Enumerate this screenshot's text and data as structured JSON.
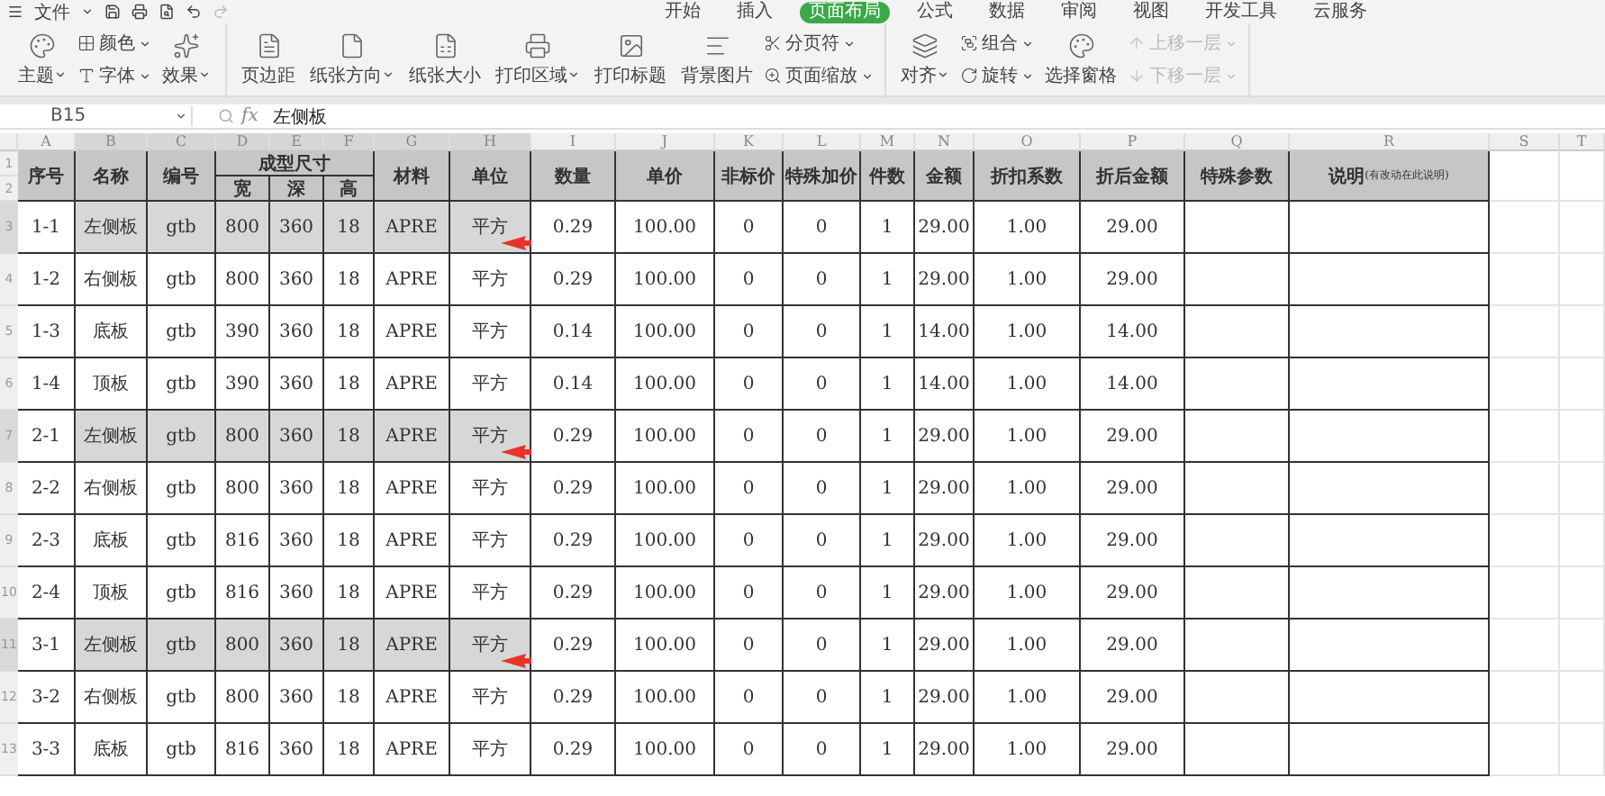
{
  "menu": {
    "file": "文件"
  },
  "ribbon_tabs": [
    {
      "label": "开始",
      "selected": false
    },
    {
      "label": "插入",
      "selected": false
    },
    {
      "label": "页面布局",
      "selected": true
    },
    {
      "label": "公式",
      "selected": false
    },
    {
      "label": "数据",
      "selected": false
    },
    {
      "label": "审阅",
      "selected": false
    },
    {
      "label": "视图",
      "selected": false
    },
    {
      "label": "开发工具",
      "selected": false
    },
    {
      "label": "云服务",
      "selected": false
    }
  ],
  "toolbar": [
    [
      {
        "kind": "big",
        "label": "主题",
        "dropdown": true
      },
      {
        "kind": "pair",
        "items": [
          {
            "label": "颜色",
            "disabled": false
          },
          {
            "label": "字体",
            "disabled": false
          }
        ]
      },
      {
        "kind": "big",
        "label": "效果",
        "dropdown": true
      }
    ],
    [
      {
        "kind": "big",
        "label": "页边距",
        "dropdown": false
      },
      {
        "kind": "big",
        "label": "纸张方向",
        "dropdown": true
      },
      {
        "kind": "big",
        "label": "纸张大小",
        "dropdown": false
      },
      {
        "kind": "big",
        "label": "打印区域",
        "dropdown": true
      },
      {
        "kind": "big",
        "label": "打印标题",
        "dropdown": false
      },
      {
        "kind": "big",
        "label": "背景图片",
        "dropdown": false
      },
      {
        "kind": "pair",
        "items": [
          {
            "label": "分页符",
            "disabled": false
          },
          {
            "label": "页面缩放",
            "disabled": false
          }
        ]
      }
    ],
    [
      {
        "kind": "big",
        "label": "对齐",
        "dropdown": true
      },
      {
        "kind": "pair",
        "items": [
          {
            "label": "组合",
            "disabled": false
          },
          {
            "label": "旋转",
            "disabled": false
          }
        ]
      },
      {
        "kind": "big",
        "label": "选择窗格",
        "dropdown": false
      },
      {
        "kind": "pair",
        "items": [
          {
            "label": "上移一层",
            "disabled": true
          },
          {
            "label": "下移一层",
            "disabled": true
          }
        ]
      }
    ]
  ],
  "formula_bar": {
    "cell_ref": "B15",
    "fx": "fx",
    "value": "左侧板"
  },
  "sheet": {
    "column_letters": [
      {
        "label": "A",
        "selected": false
      },
      {
        "label": "B",
        "selected": true
      },
      {
        "label": "C",
        "selected": true
      },
      {
        "label": "D",
        "selected": true
      },
      {
        "label": "E",
        "selected": true
      },
      {
        "label": "F",
        "selected": true
      },
      {
        "label": "G",
        "selected": true
      },
      {
        "label": "H",
        "selected": true
      },
      {
        "label": "I",
        "selected": false
      },
      {
        "label": "J",
        "selected": false
      },
      {
        "label": "K",
        "selected": false
      },
      {
        "label": "L",
        "selected": false
      },
      {
        "label": "M",
        "selected": false
      },
      {
        "label": "N",
        "selected": false
      },
      {
        "label": "O",
        "selected": false
      },
      {
        "label": "P",
        "selected": false
      },
      {
        "label": "Q",
        "selected": false
      },
      {
        "label": "R",
        "selected": false
      },
      {
        "label": "S",
        "selected": false
      },
      {
        "label": "T",
        "selected": false
      }
    ],
    "header_row_numbers": [
      "1",
      "2"
    ],
    "header": {
      "no": "序号",
      "name": "名称",
      "code": "编号",
      "size": "成型尺寸",
      "size_parts": [
        "宽",
        "深",
        "高"
      ],
      "material": "材料",
      "unit": "单位",
      "qty": "数量",
      "price": "单价",
      "nonstd": "非标价",
      "surcharge": "特殊加价",
      "count": "件数",
      "amount": "金额",
      "discount": "折扣系数",
      "final": "折后金额",
      "special": "特殊参数",
      "note": "说明",
      "note_hint": "(有改动在此说明)"
    },
    "rows": [
      {
        "row_number": "3",
        "selected": true,
        "arrow": true,
        "cells": [
          "1-1",
          "左侧板",
          "gtb",
          "800",
          "360",
          "18",
          "APRE",
          "平方",
          "0.29",
          "100.00",
          "0",
          "0",
          "1",
          "29.00",
          "1.00",
          "29.00"
        ]
      },
      {
        "row_number": "4",
        "selected": false,
        "arrow": false,
        "cells": [
          "1-2",
          "右侧板",
          "gtb",
          "800",
          "360",
          "18",
          "APRE",
          "平方",
          "0.29",
          "100.00",
          "0",
          "0",
          "1",
          "29.00",
          "1.00",
          "29.00"
        ]
      },
      {
        "row_number": "5",
        "selected": false,
        "arrow": false,
        "cells": [
          "1-3",
          "底板",
          "gtb",
          "390",
          "360",
          "18",
          "APRE",
          "平方",
          "0.14",
          "100.00",
          "0",
          "0",
          "1",
          "14.00",
          "1.00",
          "14.00"
        ]
      },
      {
        "row_number": "6",
        "selected": false,
        "arrow": false,
        "cells": [
          "1-4",
          "顶板",
          "gtb",
          "390",
          "360",
          "18",
          "APRE",
          "平方",
          "0.14",
          "100.00",
          "0",
          "0",
          "1",
          "14.00",
          "1.00",
          "14.00"
        ]
      },
      {
        "row_number": "7",
        "selected": true,
        "arrow": true,
        "cells": [
          "2-1",
          "左侧板",
          "gtb",
          "800",
          "360",
          "18",
          "APRE",
          "平方",
          "0.29",
          "100.00",
          "0",
          "0",
          "1",
          "29.00",
          "1.00",
          "29.00"
        ]
      },
      {
        "row_number": "8",
        "selected": false,
        "arrow": false,
        "cells": [
          "2-2",
          "右侧板",
          "gtb",
          "800",
          "360",
          "18",
          "APRE",
          "平方",
          "0.29",
          "100.00",
          "0",
          "0",
          "1",
          "29.00",
          "1.00",
          "29.00"
        ]
      },
      {
        "row_number": "9",
        "selected": false,
        "arrow": false,
        "cells": [
          "2-3",
          "底板",
          "gtb",
          "816",
          "360",
          "18",
          "APRE",
          "平方",
          "0.29",
          "100.00",
          "0",
          "0",
          "1",
          "29.00",
          "1.00",
          "29.00"
        ]
      },
      {
        "row_number": "10",
        "selected": false,
        "arrow": false,
        "cells": [
          "2-4",
          "顶板",
          "gtb",
          "816",
          "360",
          "18",
          "APRE",
          "平方",
          "0.29",
          "100.00",
          "0",
          "0",
          "1",
          "29.00",
          "1.00",
          "29.00"
        ]
      },
      {
        "row_number": "11",
        "selected": true,
        "arrow": true,
        "cells": [
          "3-1",
          "左侧板",
          "gtb",
          "800",
          "360",
          "18",
          "APRE",
          "平方",
          "0.29",
          "100.00",
          "0",
          "0",
          "1",
          "29.00",
          "1.00",
          "29.00"
        ]
      },
      {
        "row_number": "12",
        "selected": false,
        "arrow": false,
        "cells": [
          "3-2",
          "右侧板",
          "gtb",
          "800",
          "360",
          "18",
          "APRE",
          "平方",
          "0.29",
          "100.00",
          "0",
          "0",
          "1",
          "29.00",
          "1.00",
          "29.00"
        ]
      },
      {
        "row_number": "13",
        "selected": false,
        "arrow": false,
        "cells": [
          "3-3",
          "底板",
          "gtb",
          "816",
          "360",
          "18",
          "APRE",
          "平方",
          "0.29",
          "100.00",
          "0",
          "0",
          "1",
          "29.00",
          "1.00",
          "29.00"
        ]
      }
    ]
  }
}
